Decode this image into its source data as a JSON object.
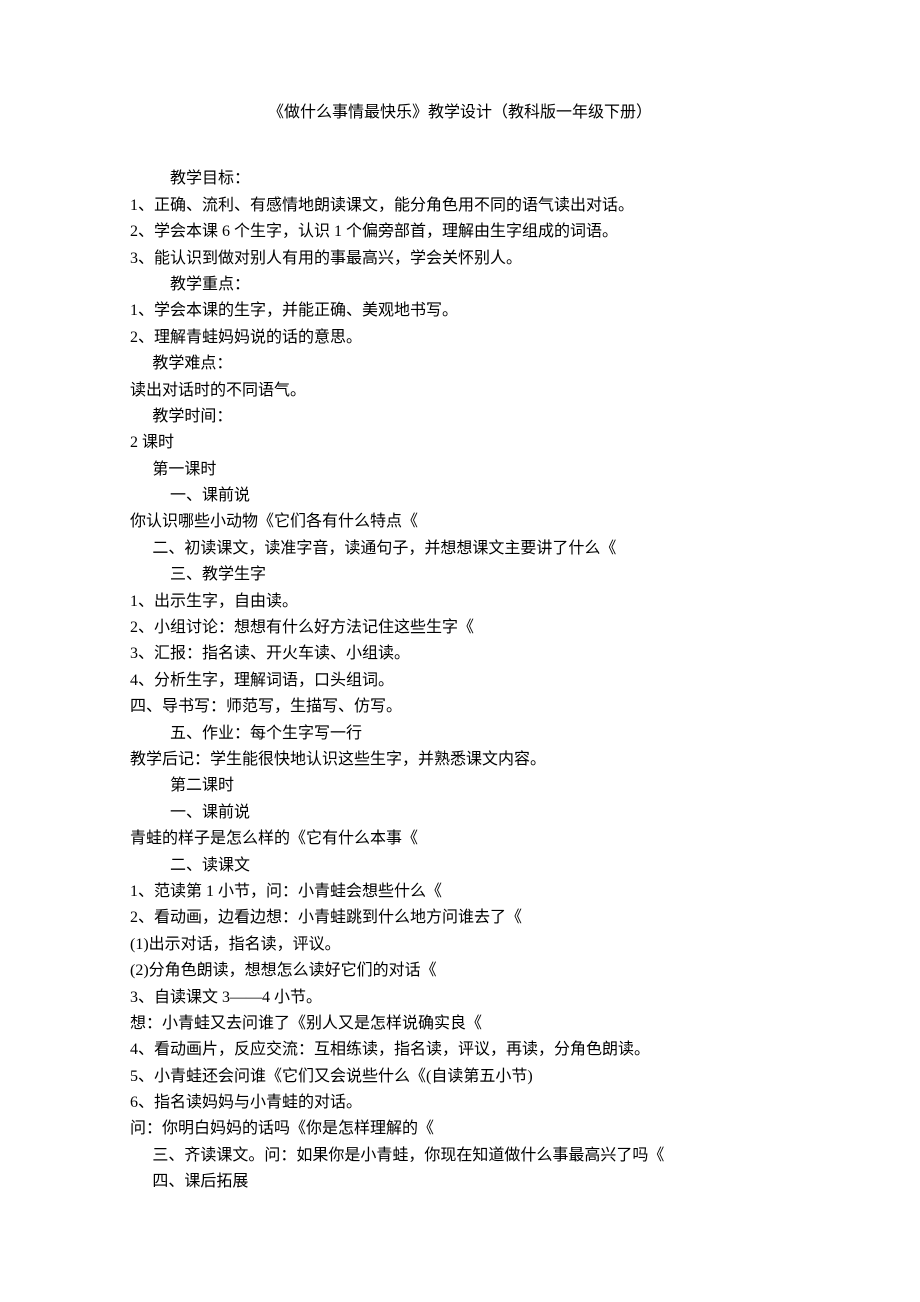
{
  "title": "《做什么事情最快乐》教学设计（教科版一年级下册）",
  "sections": {
    "goals_header": "教学目标：",
    "goals": [
      "1、正确、流利、有感情地朗读课文，能分角色用不同的语气读出对话。",
      "2、学会本课 6 个生字，认识 1 个偏旁部首，理解由生字组成的词语。",
      "3、能认识到做对别人有用的事最高兴，学会关怀别人。"
    ],
    "key_header": "教学重点：",
    "keys": [
      "1、学会本课的生字，并能正确、美观地书写。",
      "2、理解青蛙妈妈说的话的意思。"
    ],
    "diff_header": "教学难点：",
    "diff_line": "读出对话时的不同语气。",
    "time_header": "教学时间：",
    "time_val": "2 课时",
    "lesson1_header": "第一课时",
    "l1_s1": "一、课前说",
    "l1_s1_body": "你认识哪些小动物《它们各有什么特点《",
    "l1_s2": "二、初读课文，读准字音，读通句子，并想想课文主要讲了什么《",
    "l1_s3": "三、教学生字",
    "l1_s3_items": [
      "1、出示生字，自由读。",
      "2、小组讨论：想想有什么好方法记住这些生字《",
      "3、汇报：指名读、开火车读、小组读。",
      "4、分析生字，理解词语，口头组词。"
    ],
    "l1_s4": "四、导书写：师范写，生描写、仿写。",
    "l1_s5": "五、作业：每个生字写一行",
    "l1_post": "教学后记：学生能很快地认识这些生字，并熟悉课文内容。",
    "lesson2_header": "第二课时",
    "l2_s1": "一、课前说",
    "l2_s1_body": "青蛙的样子是怎么样的《它有什么本事《",
    "l2_s2": "二、读课文",
    "l2_s2_items": [
      "1、范读第 1 小节，问：小青蛙会想些什么《",
      "2、看动画，边看边想：小青蛙跳到什么地方问谁去了《",
      "(1)出示对话，指名读，评议。",
      "(2)分角色朗读，想想怎么读好它们的对话《",
      "3、自读课文 3——4 小节。",
      "想：小青蛙又去问谁了《别人又是怎样说确实良《",
      "4、看动画片，反应交流：互相练读，指名读，评议，再读，分角色朗读。",
      "5、小青蛙还会问谁《它们又会说些什么《(自读第五小节)",
      "6、指名读妈妈与小青蛙的对话。",
      "问：你明白妈妈的话吗《你是怎样理解的《"
    ],
    "l2_s3": "三、齐读课文。问：如果你是小青蛙，你现在知道做什么事最高兴了吗《",
    "l2_s4": "四、课后拓展"
  }
}
